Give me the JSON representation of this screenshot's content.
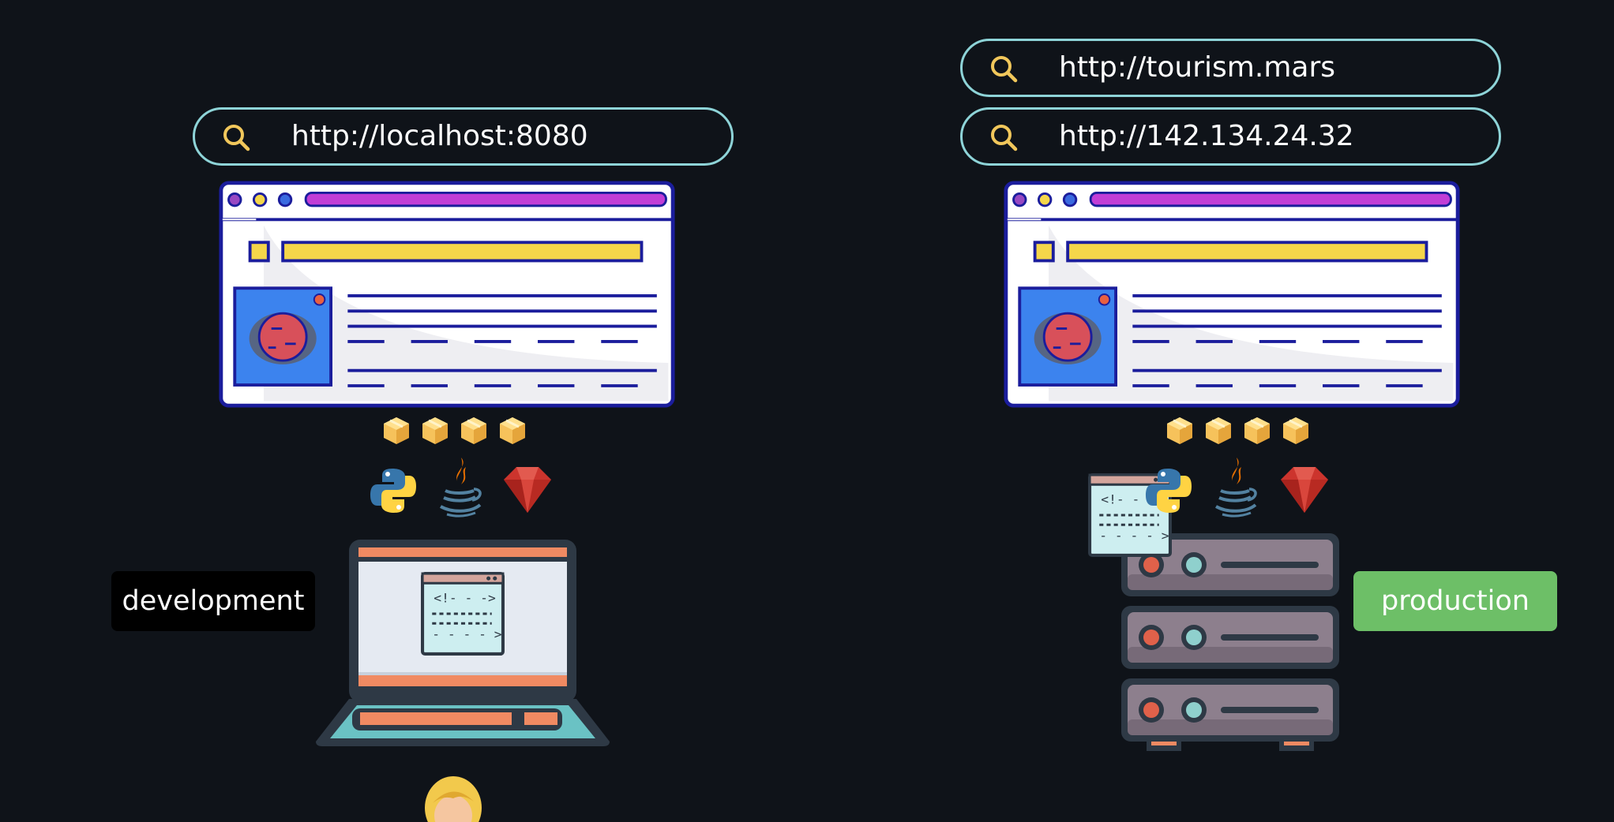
{
  "left": {
    "url": "http://localhost:8080",
    "env_label": "development"
  },
  "right": {
    "urls": [
      "http://tourism.mars",
      "http://142.134.24.32"
    ],
    "env_label": "production"
  },
  "colors": {
    "background": "#0f1319",
    "urlbar_border": "#8ed4d8",
    "search_icon": "#f1c75b",
    "browser_accent": "#c13dd6",
    "browser_outline": "#1b1d9c",
    "yellow_bar": "#f5d64a",
    "development_badge": "#000000",
    "production_badge": "#6dbf67",
    "server": "#8d7f8d",
    "laptop": "#2e3945"
  },
  "icons": {
    "language_icons": [
      "python-icon",
      "java-icon",
      "ruby-icon"
    ],
    "package_icon": "package-box-icon",
    "search_icon": "search-icon",
    "person": "person-emoji",
    "machines": [
      "laptop-icon",
      "server-rack-icon"
    ]
  }
}
